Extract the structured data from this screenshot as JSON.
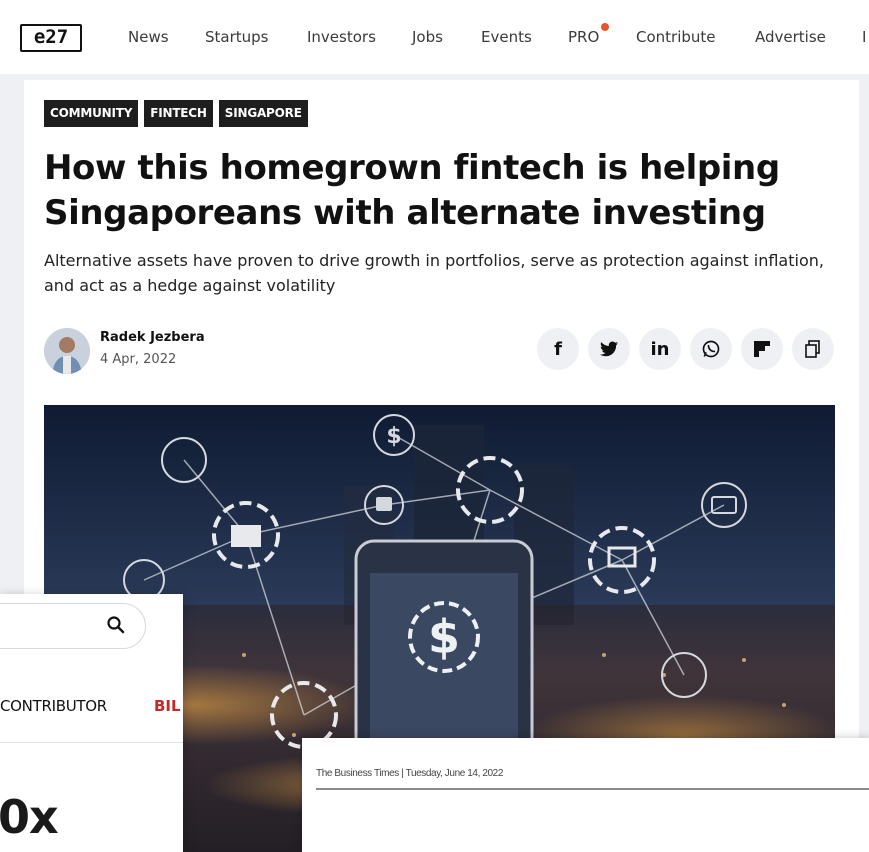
{
  "nav": {
    "logo": "e27",
    "items": [
      "News",
      "Startups",
      "Investors",
      "Jobs",
      "Events",
      "PRO",
      "Contribute",
      "Advertise"
    ]
  },
  "article": {
    "tags": [
      "COMMUNITY",
      "FINTECH",
      "SINGAPORE"
    ],
    "headline": "How this homegrown fintech is helping Singaporeans with alternate investing",
    "subhead": "Alternative assets have proven to drive growth in portfolios, serve as protection against inflation, and act as a hedge against volatility",
    "author": "Radek Jezbera",
    "date": "4 Apr, 2022",
    "share_icons": [
      "facebook-icon",
      "twitter-icon",
      "linkedin-icon",
      "whatsapp-icon",
      "flipboard-icon",
      "copy-icon"
    ],
    "share_labels": [
      "f",
      "",
      "in",
      "",
      "",
      ""
    ]
  },
  "overlay_left": {
    "search_icon": "search-icon",
    "nav_text": "CONTRIBUTOR",
    "nav_text_accent": "BIL",
    "big_text": "0x"
  },
  "overlay_bottom": {
    "header": "The Business Times  |  Tuesday, June 14, 2022"
  },
  "colors": {
    "accent_red": "#c62828",
    "pro_dot": "#e4572e",
    "tag_bg": "#1e1e1e"
  }
}
